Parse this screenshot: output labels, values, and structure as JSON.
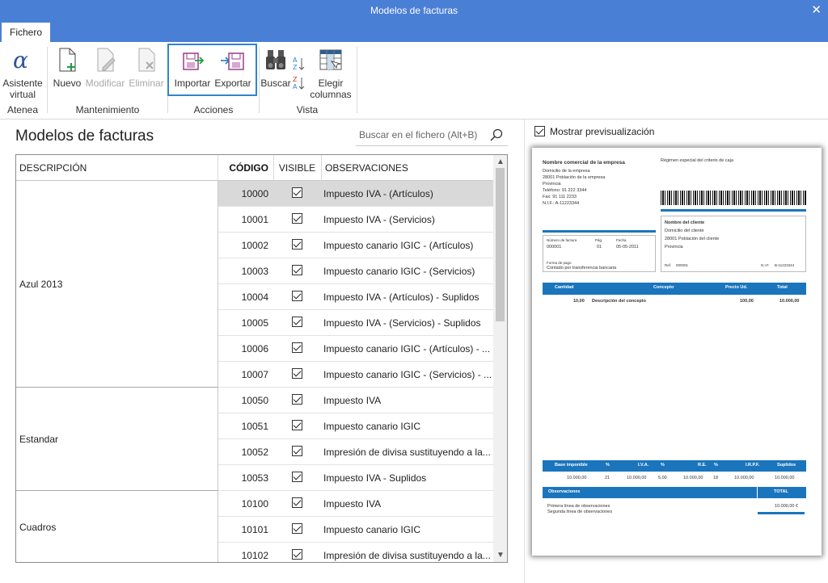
{
  "window": {
    "title": "Modelos de facturas",
    "close_label": "✕"
  },
  "tabs": [
    {
      "label": "Fichero"
    }
  ],
  "ribbon": {
    "atenea": {
      "group": "Atenea",
      "asistente": "Asistente virtual"
    },
    "mantenimiento": {
      "group": "Mantenimiento",
      "nuevo": "Nuevo",
      "modificar": "Modificar",
      "eliminar": "Eliminar"
    },
    "acciones": {
      "group": "Acciones",
      "importar": "Importar",
      "exportar": "Exportar"
    },
    "vista": {
      "group": "Vista",
      "buscar": "Buscar",
      "elegir": "Elegir columnas"
    }
  },
  "page": {
    "heading": "Modelos de facturas"
  },
  "search": {
    "placeholder": "Buscar en el fichero (Alt+B)"
  },
  "table": {
    "headers": {
      "descripcion": "DESCRIPCIÓN",
      "codigo": "CÓDIGO",
      "visible": "VISIBLE",
      "observaciones": "OBSERVACIONES"
    },
    "groups": [
      {
        "label": "Azul 2013",
        "rows": [
          {
            "codigo": "10000",
            "visible": true,
            "obs": "Impuesto IVA - (Artículos)",
            "selected": true
          },
          {
            "codigo": "10001",
            "visible": true,
            "obs": "Impuesto IVA - (Servicios)"
          },
          {
            "codigo": "10002",
            "visible": true,
            "obs": "Impuesto canario IGIC - (Artículos)"
          },
          {
            "codigo": "10003",
            "visible": true,
            "obs": "Impuesto canario IGIC - (Servicios)"
          },
          {
            "codigo": "10004",
            "visible": true,
            "obs": "Impuesto IVA - (Artículos) - Suplidos"
          },
          {
            "codigo": "10005",
            "visible": true,
            "obs": "Impuesto IVA - (Servicios) - Suplidos"
          },
          {
            "codigo": "10006",
            "visible": true,
            "obs": "Impuesto canario IGIC - (Artículos) - ..."
          },
          {
            "codigo": "10007",
            "visible": true,
            "obs": "Impuesto canario IGIC - (Servicios) - ..."
          }
        ]
      },
      {
        "label": "Estandar",
        "rows": [
          {
            "codigo": "10050",
            "visible": true,
            "obs": "Impuesto IVA"
          },
          {
            "codigo": "10051",
            "visible": true,
            "obs": "Impuesto canario IGIC"
          },
          {
            "codigo": "10052",
            "visible": true,
            "obs": "Impresión de divisa sustituyendo a la..."
          },
          {
            "codigo": "10053",
            "visible": true,
            "obs": "Impuesto IVA - Suplidos"
          }
        ]
      },
      {
        "label": "Cuadros",
        "rows": [
          {
            "codigo": "10100",
            "visible": true,
            "obs": "Impuesto IVA"
          },
          {
            "codigo": "10101",
            "visible": true,
            "obs": "Impuesto canario IGIC"
          },
          {
            "codigo": "10102",
            "visible": true,
            "obs": "Impresión de divisa sustituyendo a la..."
          }
        ]
      }
    ]
  },
  "preview_toggle": {
    "label": "Mostrar previsualización",
    "checked": true
  },
  "preview": {
    "empresa": "Nombre comercial de la empresa",
    "domicilio": "Domicilio de la empresa",
    "poblacion": "28001    Población de la empresa",
    "provincia": "Provincia",
    "telefono": "Teléfono:   91 222 3344",
    "fax": "Fax:   91 111 2233",
    "nif": "N.I.F.:  A-11223344",
    "regimen": "Régimen especial del criterio de caja",
    "cliente_nombre": "Nombre del cliente",
    "cliente_domicilio": "Domicilio del cliente",
    "cliente_poblacion": "28001 Población del cliente",
    "cliente_provincia": "Provincia",
    "ref_label": "Ref.",
    "ref_value": "000001",
    "nif_label": "N.I.F.",
    "nif_value": "B-11223344",
    "factura_labels": [
      "Número de factura",
      "Pág.",
      "Fecha"
    ],
    "factura_values": [
      "000001",
      "01",
      "05-05-2011"
    ],
    "forma_pago_label": "Forma de pago",
    "forma_pago": "Contado por transferencia bancaria",
    "line_headers": [
      "Cantidad",
      "Concepto",
      "Precio Ud.",
      "Total"
    ],
    "line": [
      "10,00",
      "Descripción del concepto",
      "100,00",
      "10.000,00"
    ],
    "tax_headers": [
      "Base imponible",
      "%",
      "I.V.A.",
      "%",
      "R.E.",
      "%",
      "I.R.P.F.",
      "Suplidos"
    ],
    "tax_values": [
      "10.000,00",
      "21",
      "10.000,00",
      "5,00",
      "10.000,00",
      "18",
      "10.000,00",
      "10.000,00"
    ],
    "obs_header": "Observaciones",
    "total_header": "TOTAL",
    "obs_lines": [
      "Primera línea de observaciones",
      "Segunda línea de observaciones"
    ],
    "total_value": "10.000,00 €"
  }
}
